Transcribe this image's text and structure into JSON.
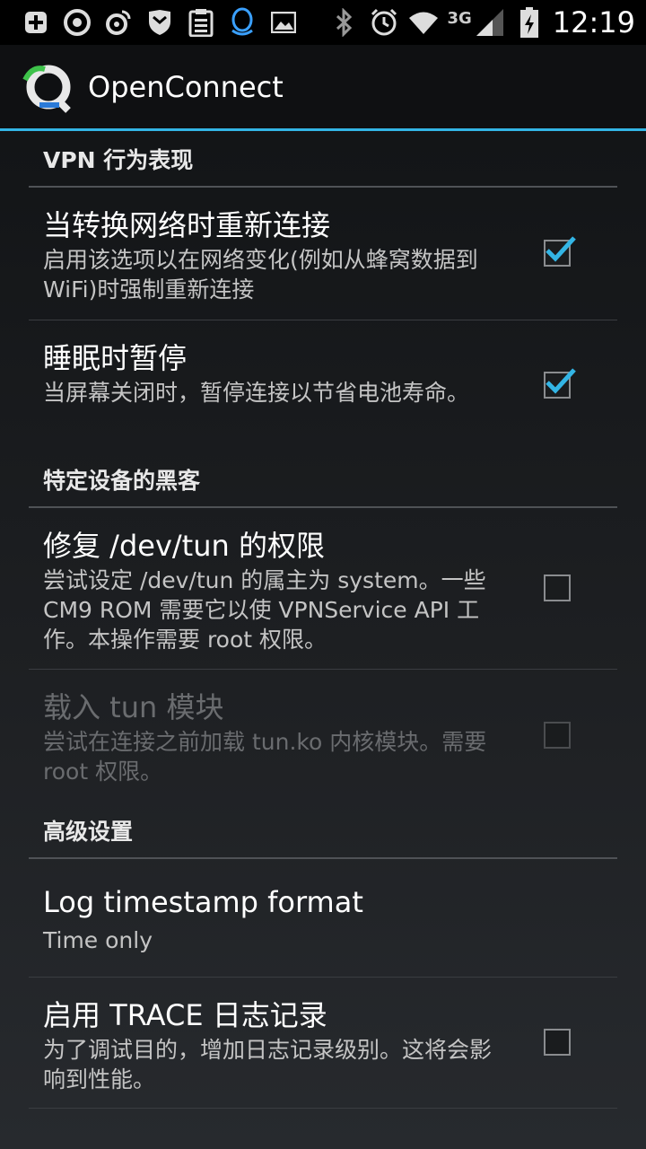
{
  "status_bar": {
    "time": "12:19",
    "network_type": "3G",
    "icons": [
      "add-icon",
      "recycle-icon",
      "weibo-icon",
      "shield-icon",
      "clipboard-icon",
      "qq-icon",
      "image-icon",
      "bluetooth-icon",
      "alarm-icon",
      "wifi-icon",
      "signal-icon",
      "battery-charging-icon"
    ]
  },
  "action_bar": {
    "title": "OpenConnect",
    "icon": "openconnect-logo-icon",
    "accent_color": "#33b5e5"
  },
  "sections": [
    {
      "header": "VPN 行为表现",
      "prefs": [
        {
          "title": "当转换网络时重新连接",
          "summary": "启用该选项以在网络变化(例如从蜂窝数据到 WiFi)时强制重新连接",
          "checked": true,
          "enabled": true
        },
        {
          "title": "睡眠时暂停",
          "summary": "当屏幕关闭时，暂停连接以节省电池寿命。",
          "checked": true,
          "enabled": true
        }
      ]
    },
    {
      "header": "特定设备的黑客",
      "prefs": [
        {
          "title": "修复 /dev/tun 的权限",
          "summary": "尝试设定 /dev/tun 的属主为 system。一些 CM9 ROM 需要它以使 VPNService API 工作。本操作需要 root 权限。",
          "checked": false,
          "enabled": true
        },
        {
          "title": "载入 tun 模块",
          "summary": "尝试在连接之前加载 tun.ko 内核模块。需要 root 权限。",
          "checked": false,
          "enabled": false
        }
      ]
    },
    {
      "header": "高级设置",
      "prefs": [
        {
          "title": "Log timestamp format",
          "summary": "Time only"
        },
        {
          "title": "启用 TRACE 日志记录",
          "summary": "为了调试目的，增加日志记录级别。这将会影响到性能。",
          "checked": false,
          "enabled": true
        }
      ]
    }
  ]
}
